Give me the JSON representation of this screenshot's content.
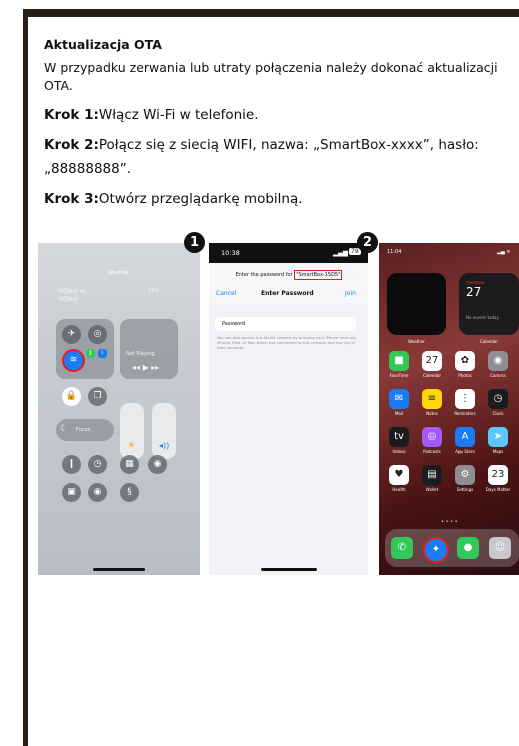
{
  "title": "Aktualizacja OTA",
  "intro": "W przypadku zerwania lub utraty połączenia należy dokonać aktualizacji OTA.",
  "steps": [
    {
      "label": "Krok 1:",
      "text": "Włącz Wi-Fi w telefonie."
    },
    {
      "label": "Krok 2:",
      "text": "Połącz się z siecią WIFI, nazwa: „SmartBox-xxxx”, hasło: „88888888”."
    },
    {
      "label": "Krok 3:",
      "text": "Otwórz przeglądarkę mobilną."
    }
  ],
  "badges": [
    "1",
    "2"
  ],
  "screen1": {
    "carrier1": "中国移动 4G",
    "carrier2": "中国移动",
    "battery": "73%",
    "weather": "Weather",
    "now_playing": "Not Playing",
    "focus": "Focus"
  },
  "screen2": {
    "time": "10:38",
    "battery": "79",
    "prompt": "Enter the password for",
    "ssid": "\"SmartBox-15D5\"",
    "cancel": "Cancel",
    "heading": "Enter Password",
    "join": "Join",
    "password_placeholder": "Password",
    "help": "You can also access this WLAN network by bringing your iPhone near any iPhone, iPad, or Mac which has connected to this network and has you in their contacts."
  },
  "screen3": {
    "time": "11:04",
    "cal_day": "THURSDAY",
    "cal_date": "27",
    "no_events": "No events today",
    "widget1_label": "Weather",
    "widget2_label": "Calendar",
    "apps": [
      {
        "label": "FaceTime",
        "icon": "facetime-icon",
        "color": "#34c759",
        "glyph": "■"
      },
      {
        "label": "Calendar",
        "icon": "calendar-icon",
        "color": "#ffffff",
        "glyph": "27"
      },
      {
        "label": "Photos",
        "icon": "photos-icon",
        "color": "#ffffff",
        "glyph": "✿"
      },
      {
        "label": "Camera",
        "icon": "camera-icon",
        "color": "#8e8e93",
        "glyph": "◉"
      },
      {
        "label": "Mail",
        "icon": "mail-icon",
        "color": "#1a7cf5",
        "glyph": "✉"
      },
      {
        "label": "Notes",
        "icon": "notes-icon",
        "color": "#ffd60a",
        "glyph": "≡"
      },
      {
        "label": "Reminders",
        "icon": "reminders-icon",
        "color": "#ffffff",
        "glyph": "⋮"
      },
      {
        "label": "Clock",
        "icon": "clock-icon",
        "color": "#1c1c1e",
        "glyph": "◷"
      },
      {
        "label": "Videos",
        "icon": "tv-icon",
        "color": "#1c1c1e",
        "glyph": "tv"
      },
      {
        "label": "Podcasts",
        "icon": "podcasts-icon",
        "color": "#a259ff",
        "glyph": "◎"
      },
      {
        "label": "App Store",
        "icon": "appstore-icon",
        "color": "#1a7cf5",
        "glyph": "A"
      },
      {
        "label": "Maps",
        "icon": "maps-icon",
        "color": "#5ac8fa",
        "glyph": "➤"
      },
      {
        "label": "Health",
        "icon": "health-icon",
        "color": "#ffffff",
        "glyph": "♥"
      },
      {
        "label": "Wallet",
        "icon": "wallet-icon",
        "color": "#1c1c1e",
        "glyph": "▤"
      },
      {
        "label": "Settings",
        "icon": "settings-icon",
        "color": "#8e8e93",
        "glyph": "⚙"
      },
      {
        "label": "Days Matter",
        "icon": "daysmatter-icon",
        "color": "#ffffff",
        "glyph": "23"
      }
    ]
  }
}
